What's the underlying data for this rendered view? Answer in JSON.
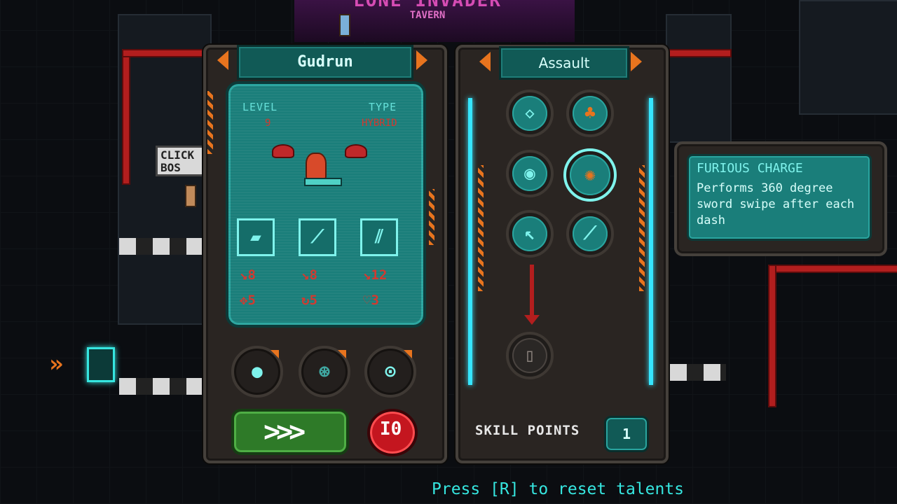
{
  "location": {
    "title": "LONE INVADER",
    "subtitle": "TAVERN"
  },
  "sign_text": "CLICK BOS",
  "character_panel": {
    "name": "Gudrun",
    "level_label": "LEVEL",
    "level_value": "9",
    "type_label": "TYPE",
    "type_value": "HYBRID",
    "weapons": [
      {
        "icon": "blaster-icon",
        "stat1": "8",
        "stat2": "5",
        "stat2_icon": "crosshair-icon"
      },
      {
        "icon": "sword-icon",
        "stat1": "8",
        "stat2": "5",
        "stat2_icon": "reload-icon"
      },
      {
        "icon": "shield-icon",
        "stat1": "12",
        "stat2": "3",
        "stat2_icon": "heart-icon"
      }
    ],
    "equipment_slots": [
      "grenade-icon",
      "drone-icon",
      "gadget-icon"
    ],
    "confirm_glyph": ">>>",
    "toggle_glyph": "I0"
  },
  "talent_panel": {
    "class_name": "Assault",
    "skill_points_label": "SKILL POINTS",
    "skill_points_value": "1",
    "talents": [
      "dash-pattern-icon",
      "clone-icon",
      "vision-icon",
      "furious-charge-icon",
      "arrow-icon",
      "blade-icon",
      "capsule-icon"
    ]
  },
  "tooltip": {
    "title": "FURIOUS CHARGE",
    "description": "Performs 360 degree sword swipe after each dash"
  },
  "hint": "Press [R] to reset talents",
  "colors": {
    "accent": "#e8741e",
    "screen": "#1a7e7a",
    "highlight": "#36e6ff",
    "stat": "#d23a30"
  }
}
